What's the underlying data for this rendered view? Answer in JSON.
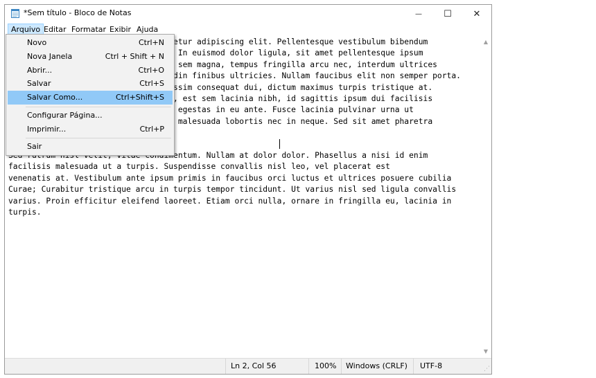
{
  "window": {
    "title": "*Sem título - Bloco de Notas",
    "controls": {
      "minimize": "—",
      "maximize": "☐",
      "close": "✕"
    }
  },
  "menubar": [
    "Arquivo",
    "Editar",
    "Formatar",
    "Exibir",
    "Ajuda"
  ],
  "file_menu": {
    "items": [
      {
        "label": "Novo",
        "shortcut": "Ctrl+N"
      },
      {
        "label": "Nova Janela",
        "shortcut": "Ctrl + Shift + N"
      },
      {
        "label": "Abrir...",
        "shortcut": "Ctrl+O"
      },
      {
        "label": "Salvar",
        "shortcut": "Ctrl+S"
      },
      {
        "label": "Salvar Como...",
        "shortcut": "Ctrl+Shift+S"
      },
      {
        "label": "Configurar Página...",
        "shortcut": ""
      },
      {
        "label": "Imprimir...",
        "shortcut": "Ctrl+P"
      },
      {
        "label": "Sair",
        "shortcut": ""
      }
    ],
    "selected": "Salvar Como..."
  },
  "editor": {
    "text": "Lorem ipsum dolor sit amet, consectetur adipiscing elit. Pellentesque vestibulum bibendum\ntincidunt. Curabitur pulvinar nisi. In euismod dolor ligula, sit amet pellentesque ipsum\nvolutpat a. Praesent euismod. Fusce sem magna, tempus fringilla arcu nec, interdum ultrices\nlibero. Vestibulum lobortis sapien din finibus ultricies. Nullam faucibus elit non semper porta.\nSed scelerisque arcu quam, et dignissim consequat dui, dictum maximus turpis tristique at.\nAenean eu ullamcorper eros. Blandit, est sem lacinia nibh, id sagittis ipsum dui facilisis\nleo. Aliquam erat volutpat. Proinia egestas in eu ante. Fusce lacinia pulvinar urna ut\nfaucibus. Donec a consequat. Tellus malesuada lobortis nec in neque. Sed sit amet pharetra\nurna.\n\nSed rutrum nisl velit, vitae condimentum. Nullam at dolor dolor. Phasellus a nisi id enim\nfacilisis malesuada ut a turpis. Suspendisse convallis nisl leo, vel placerat est\nvenenatis at. Vestibulum ante ipsum primis in faucibus orci luctus et ultrices posuere cubilia\nCurae; Curabitur tristique arcu in turpis tempor tincidunt. Ut varius nisl sed ligula convallis\nvarius. Proin efficitur eleifend laoreet. Etiam orci nulla, ornare in fringilla eu, lacinia in\nturpis."
  },
  "statusbar": {
    "position": "Ln 2, Col 56",
    "zoom": "100%",
    "line_ending": "Windows (CRLF)",
    "encoding": "UTF-8"
  },
  "colors": {
    "selected_menu_item": "#91c9f7",
    "active_menubar_item": "#cce8ff",
    "status_bar_bg": "#f0f0f0"
  }
}
